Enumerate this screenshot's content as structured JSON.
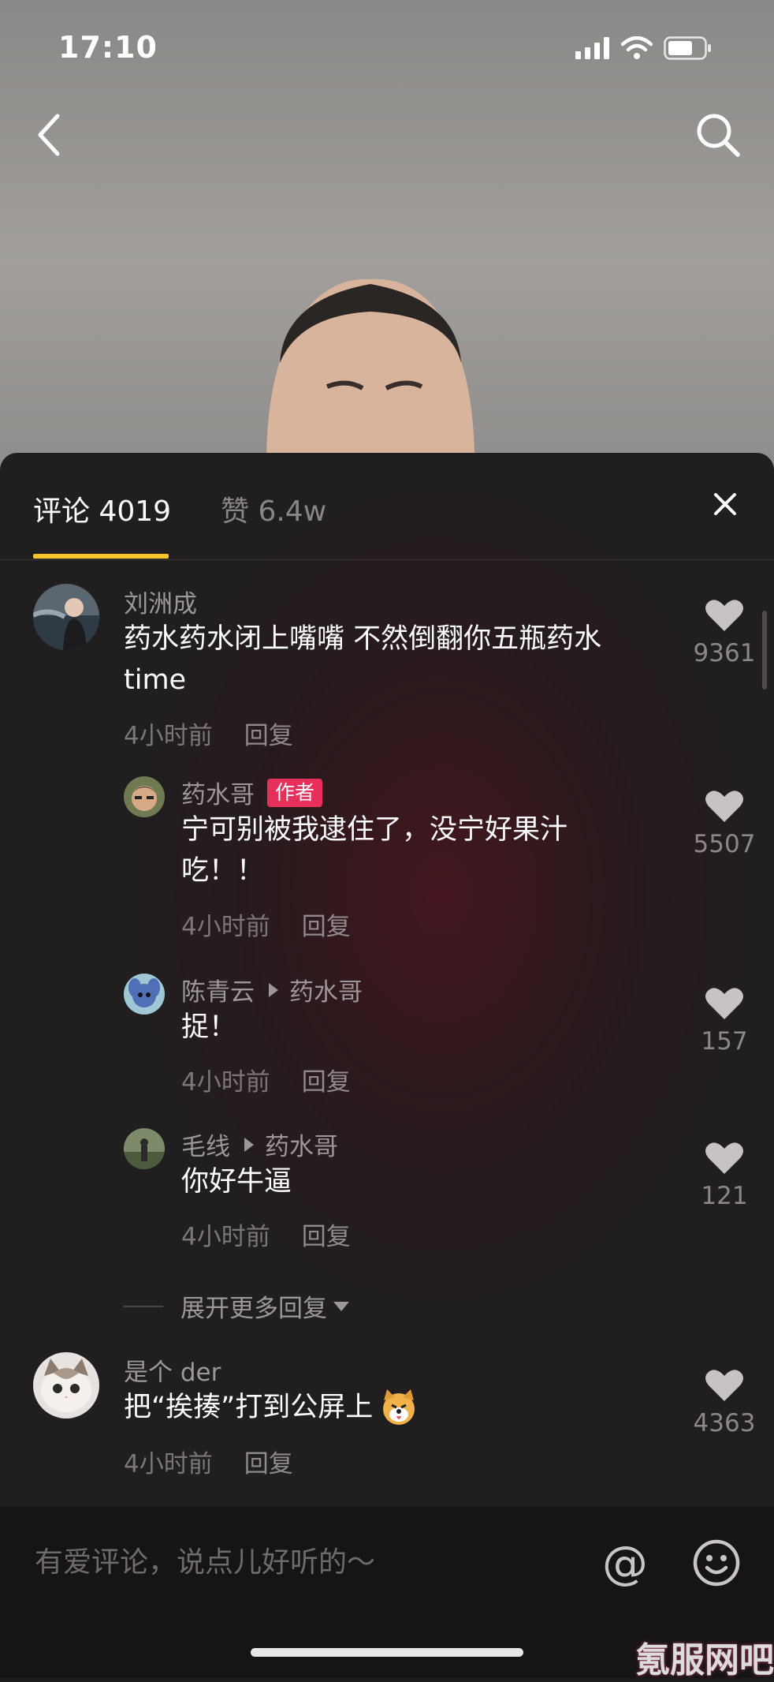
{
  "status_bar": {
    "time": "17:10"
  },
  "tabs": {
    "comments": "评论 4019",
    "likes": "赞 6.4w"
  },
  "comments": [
    {
      "user": "刘洲成",
      "lines": [
        "药水药水闭上嘴嘴 不然倒翻你五瓶药水",
        "time"
      ],
      "time": "4小时前",
      "reply": "回复",
      "likes": "9361"
    },
    {
      "user": "药水哥",
      "badge": "作者",
      "lines": [
        "宁可别被我逮住了，没宁好果汁",
        "吃！！"
      ],
      "time": "4小时前",
      "reply": "回复",
      "likes": "5507"
    },
    {
      "user": "陈青云",
      "reply_to": "药水哥",
      "lines": [
        "捉！"
      ],
      "time": "4小时前",
      "reply": "回复",
      "likes": "157"
    },
    {
      "user": "毛线",
      "reply_to": "药水哥",
      "lines": [
        "你好牛逼"
      ],
      "time": "4小时前",
      "reply": "回复",
      "likes": "121"
    },
    {
      "user": "是个 der",
      "lines": [
        "把“挨揍”打到公屏上"
      ],
      "time": "4小时前",
      "reply": "回复",
      "likes": "4363"
    }
  ],
  "expand_more": "展开更多回复",
  "input": {
    "placeholder": "有爱评论，说点儿好听的～"
  },
  "icons": {
    "back": "back-chevron-icon",
    "search": "search-icon",
    "close": "close-icon",
    "heart": "heart-icon",
    "at": "at-icon",
    "emoji": "emoji-icon"
  },
  "watermark": "氪服网吧",
  "colors": {
    "accent": "#f4c52b",
    "author_badge": "#e6305a"
  }
}
